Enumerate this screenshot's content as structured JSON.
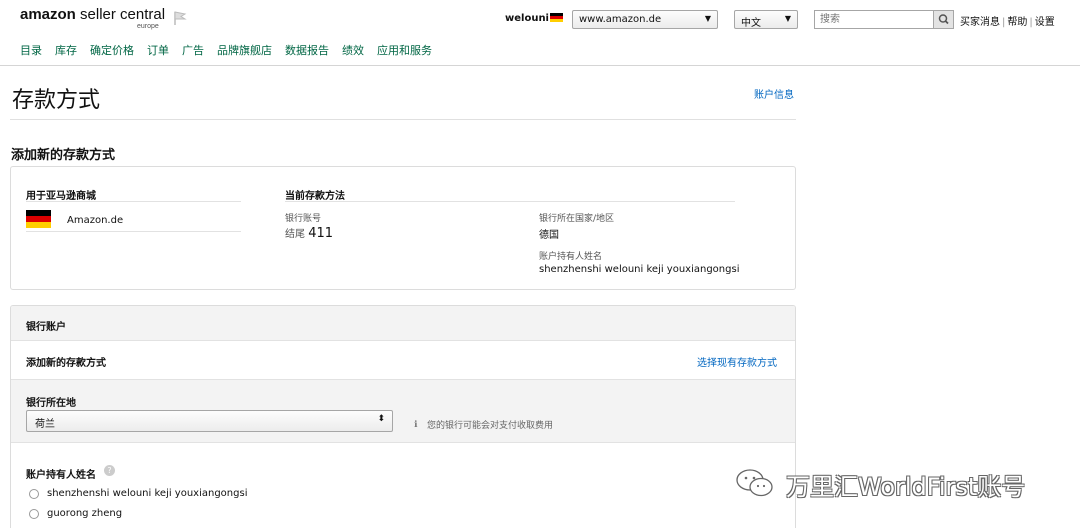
{
  "header": {
    "logo_main_bold": "amazon",
    "logo_main_rest": " seller central",
    "logo_sub": "europe",
    "store_name": "welouni",
    "marketplace": "www.amazon.de",
    "language": "中文",
    "search_placeholder": "搜索",
    "links": [
      "买家消息",
      "帮助",
      "设置"
    ]
  },
  "nav": [
    "目录",
    "库存",
    "确定价格",
    "订单",
    "广告",
    "品牌旗舰店",
    "数据报告",
    "绩效",
    "应用和服务"
  ],
  "page": {
    "title": "存款方式",
    "account_info_link": "账户信息",
    "section_title": "添加新的存款方式"
  },
  "current_method": {
    "marketplace_col_label": "用于亚马逊商城",
    "marketplace_name": "Amazon.de",
    "method_col_label": "当前存款方法",
    "account_number_label": "银行账号",
    "account_ending_prefix": "结尾",
    "account_ending_digits": "411",
    "bank_country_label": "银行所在国家/地区",
    "bank_country": "德国",
    "holder_label": "账户持有人姓名",
    "holder_name": "shenzhenshi welouni keji youxiangongsi"
  },
  "bank_account": {
    "panel_title": "银行账户",
    "add_new_title": "添加新的存款方式",
    "choose_existing_link": "选择现有存款方式",
    "location_label": "银行所在地",
    "location_value": "荷兰",
    "fee_note": "您的银行可能会对支付收取费用",
    "holder_name_label": "账户持有人姓名",
    "holder_options": [
      "shenzhenshi welouni keji youxiangongsi",
      "guorong zheng"
    ]
  },
  "watermark": {
    "text": "万里汇WorldFirst账号"
  },
  "colors": {
    "nav_text": "#006644",
    "link": "#0066c0",
    "flag_black": "#000000",
    "flag_red": "#dd0000",
    "flag_gold": "#ffce00"
  }
}
